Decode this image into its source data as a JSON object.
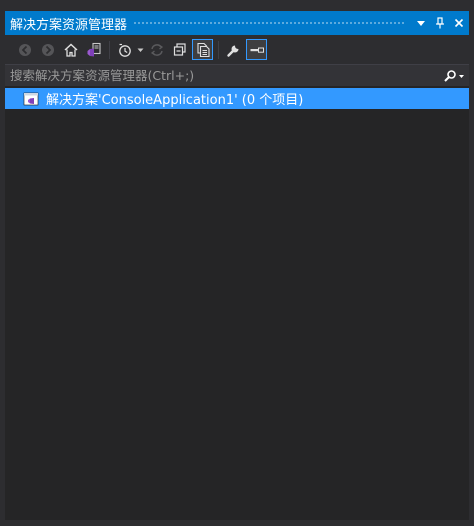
{
  "window": {
    "title": "解决方案资源管理器",
    "buttons": {
      "dropdown_icon": "dropdown-triangle-icon",
      "pin_icon": "pin-icon",
      "close_icon": "close-icon"
    }
  },
  "toolbar": {
    "buttons": [
      {
        "name": "back-button",
        "icon": "back-icon",
        "enabled": false
      },
      {
        "name": "forward-button",
        "icon": "forward-icon",
        "enabled": false
      },
      {
        "name": "home-button",
        "icon": "home-icon",
        "enabled": true
      },
      {
        "name": "switch-views-button",
        "icon": "visual-studio-icon",
        "enabled": true
      },
      {
        "name": "pending-changes-filter-button",
        "icon": "clock-icon",
        "enabled": true
      },
      {
        "name": "sync-active-document-button",
        "icon": "sync-icon",
        "enabled": false
      },
      {
        "name": "collapse-all-button",
        "icon": "collapse-all-icon",
        "enabled": true
      },
      {
        "name": "show-all-files-button",
        "icon": "show-all-files-icon",
        "enabled": true,
        "active": true
      },
      {
        "name": "properties-button",
        "icon": "wrench-icon",
        "enabled": true
      },
      {
        "name": "preview-selected-items-button",
        "icon": "preview-icon",
        "enabled": true,
        "active": true
      }
    ]
  },
  "search": {
    "placeholder": "搜索解决方案资源管理器(Ctrl+;)",
    "value": "",
    "icon": "search-icon"
  },
  "tree": {
    "items": [
      {
        "label": "解决方案'ConsoleApplication1' (0 个项目)",
        "icon": "solution-icon",
        "selected": true
      }
    ]
  },
  "colors": {
    "accent": "#007acc",
    "selection": "#3399ff",
    "background": "#2d2d30",
    "tree_background": "#252526",
    "text": "#f1f1f1",
    "placeholder": "#999999"
  }
}
